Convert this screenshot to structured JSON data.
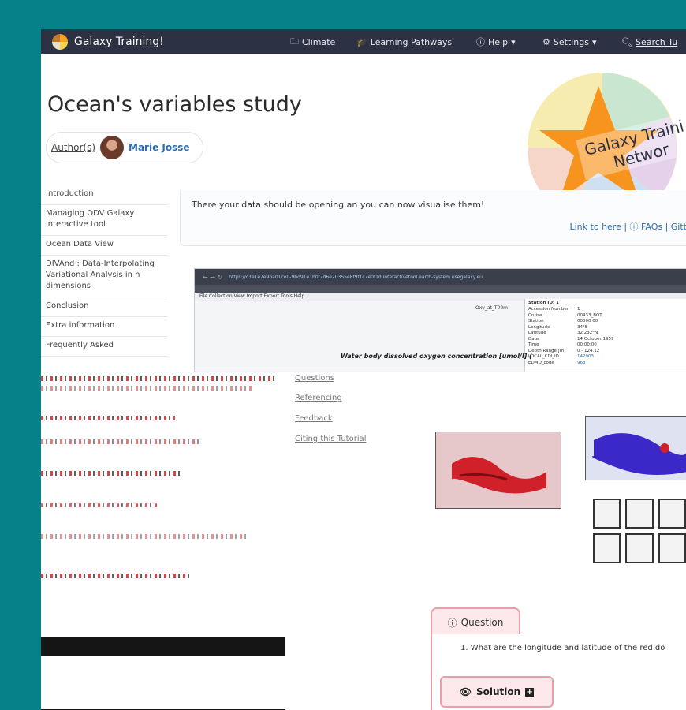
{
  "navbar": {
    "brand": "Galaxy Training!",
    "items": [
      {
        "icon": "folder-icon",
        "label": "Climate"
      },
      {
        "icon": "graduation-cap-icon",
        "label": "Learning Pathways"
      },
      {
        "icon": "help-circle-icon",
        "label": "Help"
      },
      {
        "icon": "gear-icon",
        "label": "Settings"
      },
      {
        "icon": "search-icon",
        "label": "Search Tu"
      }
    ]
  },
  "page": {
    "title": "Ocean's variables study",
    "author_label": "Author(s)",
    "author_name": "Marie Josse"
  },
  "logo": {
    "line1": "Galaxy Traini",
    "line2": "Networ"
  },
  "sidebar": {
    "items": [
      "Introduction",
      "Managing ODV Galaxy interactive tool",
      "Ocean Data View",
      "DIVAnd : Data-Interpolating Variational Analysis in n dimensions",
      "Conclusion",
      "Extra information",
      "Frequently Asked"
    ]
  },
  "content": {
    "text": "There your data should be opening an you can now visualise them!",
    "links": "Link to here | ⓘ FAQs | Gitt"
  },
  "screenshot": {
    "url": "https://c3e1e7e9ba01ce0-9bd91e1b0f7d6e20355e8f9f1c7e0f1d.interactivetool.earth-system.usegalaxy.eu",
    "menu": "File  Collection  View  Import  Export  Tools  Help",
    "tab": "Oxy_at_T00m",
    "plot_title": "Water body dissolved oxygen concentration [umol/l] (",
    "station_header": "Station ID: 1",
    "station_rows": [
      [
        "Accession Number",
        "1"
      ],
      [
        "Cruise",
        "00433_BOT"
      ],
      [
        "Station",
        "00000 00"
      ],
      [
        "Longitude",
        "34°E"
      ],
      [
        "Latitude",
        "32.232°N"
      ],
      [
        "Date",
        "14 October 1959"
      ],
      [
        "Time",
        "00:00:00"
      ],
      [
        "Depth Range [m]",
        "0 - 124.12"
      ],
      [
        "LOCAL_CDI_ID",
        "142903"
      ],
      [
        "EDMO_code",
        "963"
      ]
    ]
  },
  "ghost_menu": [
    "Questions",
    "Referencing",
    "Feedback",
    "Citing this Tutorial"
  ],
  "question": {
    "label": "Question",
    "text": "1. What are the longitude and latitude of the red do",
    "solution_label": "Solution"
  },
  "colors": {
    "background": "#06818a",
    "navbar": "#2c3143",
    "link": "#2a6db5",
    "question_border": "#e6a0a8"
  }
}
